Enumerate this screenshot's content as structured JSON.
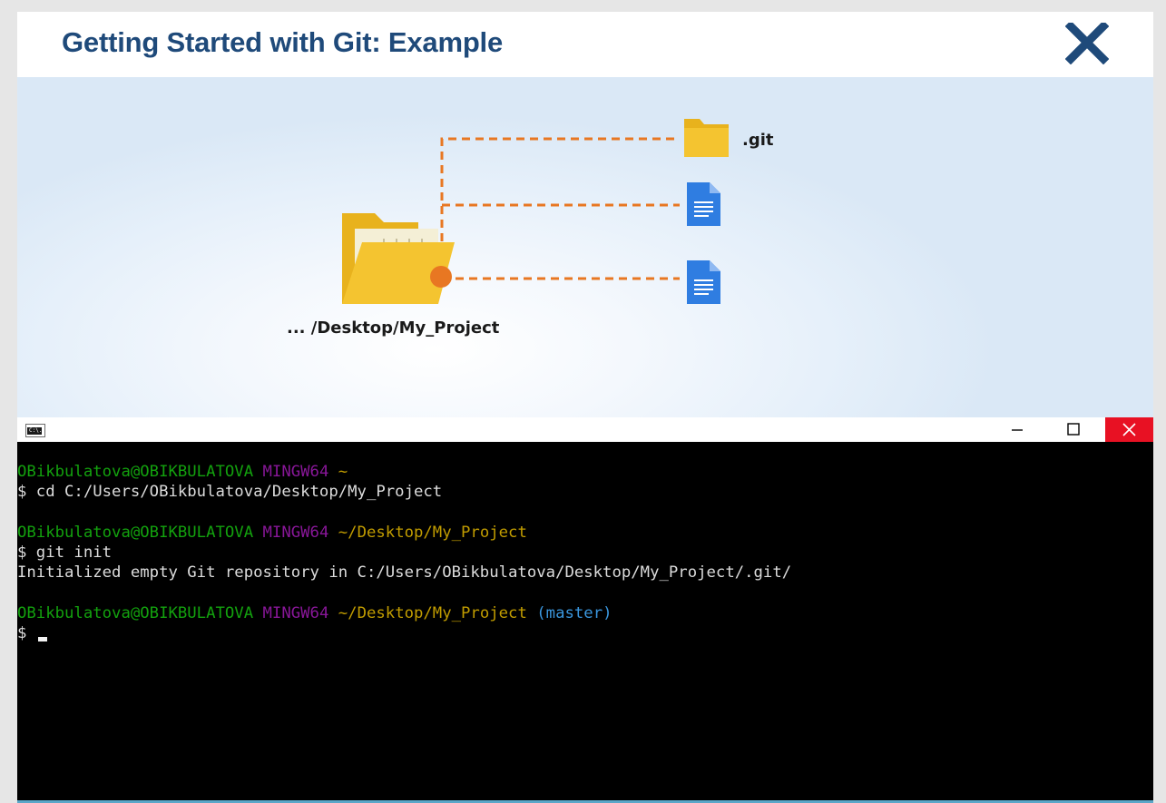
{
  "title": "Getting Started with Git: Example",
  "icons": {
    "close": "close-x-icon",
    "folder_open": "open-folder-icon",
    "folder_git": "folder-icon",
    "document": "document-icon",
    "terminal_app": "console-icon",
    "minimize": "minimize-icon",
    "maximize": "maximize-icon",
    "window_close": "window-close-icon"
  },
  "colors": {
    "title": "#1f4a7a",
    "connector": "#e87722",
    "folder": "#f4c430",
    "document": "#2f7de1",
    "window_close": "#e81123",
    "user": "#13a10e",
    "env": "#881798",
    "path": "#c19c00",
    "branch": "#3a96dd"
  },
  "diagram": {
    "project_label": "... /Desktop/My_Project",
    "git_label": ".git"
  },
  "terminal": {
    "app_icon_text": "C:\\.",
    "blocks": [
      {
        "user": "OBikbulatova@OBIKBULATOVA",
        "env": "MINGW64",
        "path": "~",
        "branch": "",
        "command": "$ cd C:/Users/OBikbulatova/Desktop/My_Project",
        "output": ""
      },
      {
        "user": "OBikbulatova@OBIKBULATOVA",
        "env": "MINGW64",
        "path": "~/Desktop/My_Project",
        "branch": "",
        "command": "$ git init",
        "output": "Initialized empty Git repository in C:/Users/OBikbulatova/Desktop/My_Project/.git/"
      },
      {
        "user": "OBikbulatova@OBIKBULATOVA",
        "env": "MINGW64",
        "path": "~/Desktop/My_Project",
        "branch": "(master)",
        "command": "$ ",
        "output": ""
      }
    ]
  }
}
